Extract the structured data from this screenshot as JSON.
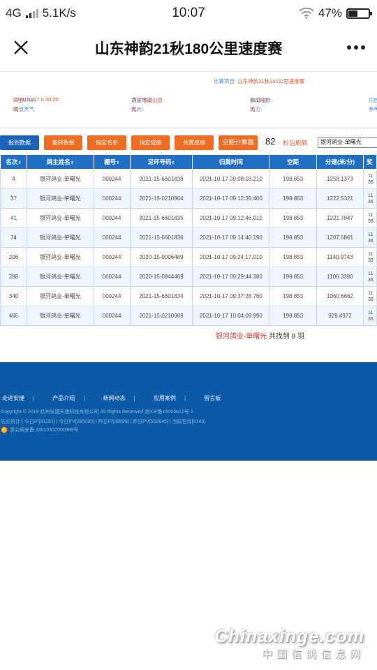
{
  "status_bar": {
    "network": "4G",
    "speed": "5.1K/s",
    "time": "10:07",
    "battery": "47%",
    "battery_level": 0.47
  },
  "nav": {
    "title": "山东神韵21秋180公里速度赛",
    "close_icon": "close-icon",
    "more_icon": "more-icon"
  },
  "info": {
    "subject_label": "比赛项目:",
    "subject_value": "山东神韵21秋180公里速度赛",
    "release_time_label": "司放时间:",
    "release_time_value": "2021/10/17 6:30:00",
    "release_place_label": "司放地点:",
    "release_place_value": "济宁市梁山县",
    "count_label": "集鸽羽数:",
    "count_value": "1319羽",
    "col4a_label": "司放",
    "weather_label": "司放天气:",
    "weather_value": "晴",
    "wind_dir_label": "风向:",
    "wind_dir_value": "无",
    "wind_force_label": "风力:",
    "wind_force_value": "无",
    "col4b_label": "参考"
  },
  "toolbar": {
    "btn_report": "报到数据",
    "btn_collect": "集鸽数据",
    "btn_list": "指定名单",
    "btn_result": "指定成绩",
    "btn_close": "关赛成绩",
    "btn_calc": "空距计算器",
    "refresh_count": "82",
    "refresh_label": "秒后刷新",
    "filter_value": "银河鸽业-单曙光"
  },
  "table": {
    "headers": [
      "名次",
      "鸽主姓名",
      "棚号",
      "足环号码",
      "归巢时间",
      "空距",
      "分速(米/分)",
      "奖"
    ],
    "sort_icon": "sort-icon",
    "rows": [
      {
        "rank": "4",
        "owner": "银河鸽业-单曙光",
        "loft": "000244",
        "ring": "2021-15-6601838",
        "time": "2021-10-17 09:08:03.210",
        "distance": "198.853",
        "speed": "1258.1373",
        "edge": "11\n36"
      },
      {
        "rank": "37",
        "owner": "银河鸽业-单曙光",
        "loft": "000244",
        "ring": "2021-15-0210904",
        "time": "2021-10-17 09:12:39.400",
        "distance": "198.853",
        "speed": "1222.5321",
        "edge": "11\n36"
      },
      {
        "rank": "41",
        "owner": "银河鸽业-单曙光",
        "loft": "000244",
        "ring": "2021-15-6601835",
        "time": "2021-10-17 09:12:46.010",
        "distance": "198.853",
        "speed": "1221.7047",
        "edge": "11\n36"
      },
      {
        "rank": "74",
        "owner": "银河鸽业-单曙光",
        "loft": "000244",
        "ring": "2021-15-6601836",
        "time": "2021-10-17 09:14:40.190",
        "distance": "198.853",
        "speed": "1207.5861",
        "edge": "11\n36"
      },
      {
        "rank": "206",
        "owner": "银河鸽业-单曙光",
        "loft": "000244",
        "ring": "2020-15-0006489",
        "time": "2021-10-17 09:24:17.010",
        "distance": "198.853",
        "speed": "1140.9743",
        "edge": "11\n36"
      },
      {
        "rank": "288",
        "owner": "银河鸽业-单曙光",
        "loft": "000244",
        "ring": "2020-15-0844469",
        "time": "2021-10-17 09:29:44.380",
        "distance": "198.853",
        "speed": "1106.3390",
        "edge": "11\n36"
      },
      {
        "rank": "340",
        "owner": "银河鸽业-单曙光",
        "loft": "000244",
        "ring": "2021-15-6601834",
        "time": "2021-10-17 09:37:28.760",
        "distance": "198.853",
        "speed": "1060.6662",
        "edge": "11\n36"
      },
      {
        "rank": "465",
        "owner": "银河鸽业-单曙光",
        "loft": "000244",
        "ring": "2021-15-0210908",
        "time": "2021-10-17 10:04:09.990",
        "distance": "198.853",
        "speed": "928.4972",
        "edge": "11\n36"
      }
    ]
  },
  "summary": {
    "name": "银河鸽业-单曙光",
    "text_pre": " 共找到 ",
    "count": "8",
    "text_post": " 羽"
  },
  "footer": {
    "links": [
      "走进安捷",
      "产品介绍",
      "新闻动态",
      "应用案例",
      "留言板"
    ],
    "separator": "|",
    "copyright": "Copyright © 2019 杭州安捷天使科技有限公司 All Rights Reserved 浙ICP备19003622号-1",
    "stats": "站长统计 | 今日IP[31281] | 今日PV[285085] | 昨日IP[39599] | 昨日PV[562645] | 当前在线[8143]",
    "police": "浙公网安备 33010502000989号"
  },
  "watermark": {
    "main": "Chinaxinge.com",
    "sub": "中国信鸽信息网"
  }
}
